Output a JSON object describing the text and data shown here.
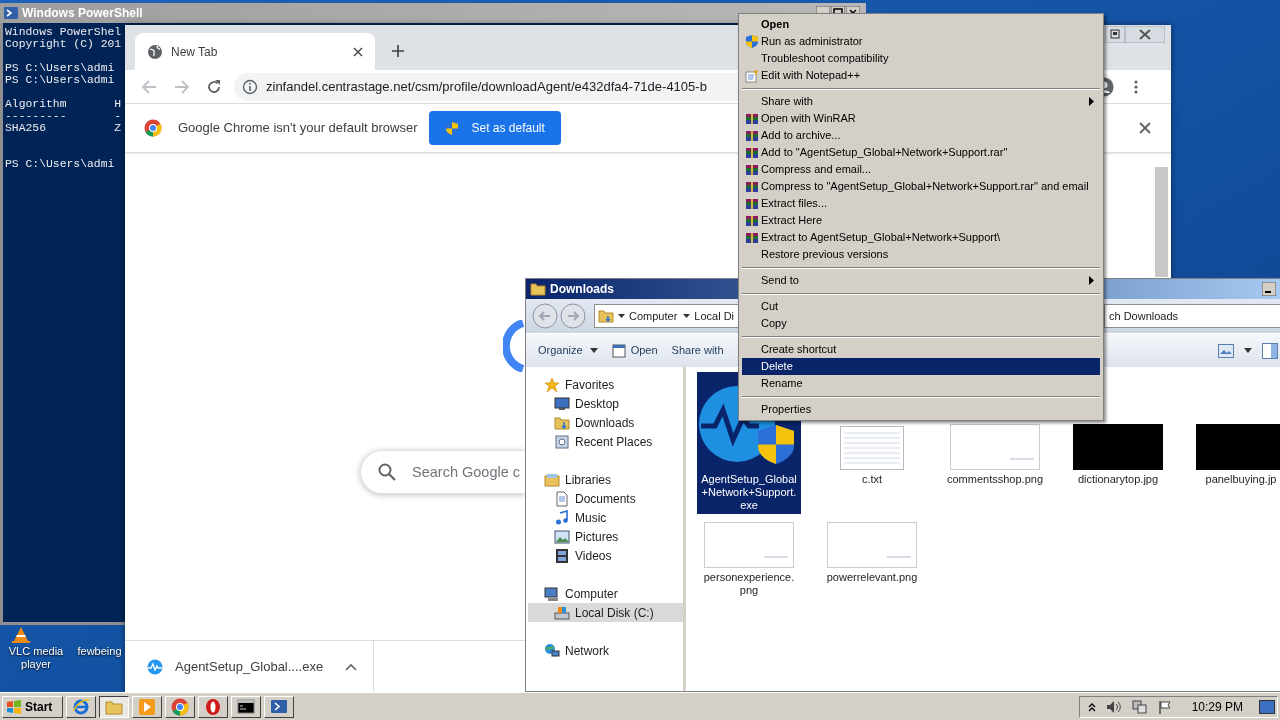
{
  "desktop": {
    "icons": [
      {
        "label": "VLC media player",
        "kind": "vlc"
      },
      {
        "label": "fewbeing",
        "kind": "file"
      }
    ]
  },
  "powershell": {
    "title": "Windows PowerShell",
    "blocks": [
      [
        "Windows PowerShel",
        "Copyright (C) 201"
      ],
      [
        "PS C:\\Users\\admi",
        "PS C:\\Users\\admi"
      ],
      [
        "Algorithm       H",
        "---------       -",
        "SHA256          Z"
      ],
      [
        "PS C:\\Users\\admi"
      ]
    ]
  },
  "chrome": {
    "tab": {
      "title": "New Tab"
    },
    "address": "zinfandel.centrastage.net/csm/profile/downloadAgent/e432dfa4-71de-4105-b",
    "infobar": {
      "message": "Google Chrome isn't your default browser",
      "button": "Set as default"
    },
    "search": {
      "placeholder": "Search Google c"
    },
    "download": {
      "filename": "AgentSetup_Global....exe"
    }
  },
  "explorer": {
    "title": "Downloads",
    "breadcrumbs": [
      "Computer",
      "Local Di"
    ],
    "search": {
      "placeholder": "ch Downloads"
    },
    "toolbar": [
      {
        "label": "Organize",
        "kind": "dropdown"
      },
      {
        "label": "Open",
        "kind": "open"
      },
      {
        "label": "Share with",
        "kind": "plain"
      }
    ],
    "nav": [
      {
        "label": "Favorites",
        "kind": "star",
        "selected": false,
        "children": [
          {
            "label": "Desktop",
            "kind": "desktop",
            "selected": false
          },
          {
            "label": "Downloads",
            "kind": "downloads",
            "selected": false
          },
          {
            "label": "Recent Places",
            "kind": "recent",
            "selected": false
          }
        ]
      },
      {
        "label": "Libraries",
        "kind": "libraries",
        "selected": false,
        "children": [
          {
            "label": "Documents",
            "kind": "documents",
            "selected": false
          },
          {
            "label": "Music",
            "kind": "music",
            "selected": false
          },
          {
            "label": "Pictures",
            "kind": "pictures",
            "selected": false
          },
          {
            "label": "Videos",
            "kind": "videos",
            "selected": false
          }
        ]
      },
      {
        "label": "Computer",
        "kind": "computer",
        "selected": false,
        "children": [
          {
            "label": "Local Disk (C:)",
            "kind": "drive",
            "selected": true
          }
        ]
      },
      {
        "label": "Network",
        "kind": "network",
        "selected": false
      }
    ],
    "files": [
      {
        "name": "AgentSetup_Global+Network+Support.exe",
        "kind": "app",
        "selected": true
      },
      {
        "name": "c.txt",
        "kind": "text",
        "selected": false
      },
      {
        "name": "commentsshop.png",
        "kind": "image-light",
        "selected": false
      },
      {
        "name": "dictionarytop.jpg",
        "kind": "image-dark",
        "selected": false
      },
      {
        "name": "panelbuying.jp",
        "kind": "image-dark",
        "selected": false
      },
      {
        "name": "personexperience.png",
        "kind": "image-light",
        "selected": false
      },
      {
        "name": "powerrelevant.png",
        "kind": "image-light",
        "selected": false
      }
    ]
  },
  "context_menu": {
    "items": [
      {
        "kind": "plain",
        "label": "Open",
        "bold": true,
        "submenu": false,
        "selected": false
      },
      {
        "kind": "shield",
        "label": "Run as administrator",
        "bold": false,
        "submenu": false,
        "selected": false
      },
      {
        "kind": "plain",
        "label": "Troubleshoot compatibility",
        "bold": false,
        "submenu": false,
        "selected": false
      },
      {
        "kind": "notepad",
        "label": "Edit with Notepad++",
        "bold": false,
        "submenu": false,
        "selected": false
      },
      {
        "kind": "separator"
      },
      {
        "kind": "plain",
        "label": "Share with",
        "bold": false,
        "submenu": true,
        "selected": false
      },
      {
        "kind": "winrar",
        "label": "Open with WinRAR",
        "bold": false,
        "submenu": false,
        "selected": false
      },
      {
        "kind": "winrar",
        "label": "Add to archive...",
        "bold": false,
        "submenu": false,
        "selected": false
      },
      {
        "kind": "winrar",
        "label": "Add to \"AgentSetup_Global+Network+Support.rar\"",
        "bold": false,
        "submenu": false,
        "selected": false
      },
      {
        "kind": "winrar",
        "label": "Compress and email...",
        "bold": false,
        "submenu": false,
        "selected": false
      },
      {
        "kind": "winrar",
        "label": "Compress to \"AgentSetup_Global+Network+Support.rar\" and email",
        "bold": false,
        "submenu": false,
        "selected": false
      },
      {
        "kind": "winrar",
        "label": "Extract files...",
        "bold": false,
        "submenu": false,
        "selected": false
      },
      {
        "kind": "winrar",
        "label": "Extract Here",
        "bold": false,
        "submenu": false,
        "selected": false
      },
      {
        "kind": "winrar",
        "label": "Extract to AgentSetup_Global+Network+Support\\",
        "bold": false,
        "submenu": false,
        "selected": false
      },
      {
        "kind": "plain",
        "label": "Restore previous versions",
        "bold": false,
        "submenu": false,
        "selected": false
      },
      {
        "kind": "separator"
      },
      {
        "kind": "plain",
        "label": "Send to",
        "bold": false,
        "submenu": true,
        "selected": false
      },
      {
        "kind": "separator"
      },
      {
        "kind": "plain",
        "label": "Cut",
        "bold": false,
        "submenu": false,
        "selected": false
      },
      {
        "kind": "plain",
        "label": "Copy",
        "bold": false,
        "submenu": false,
        "selected": false
      },
      {
        "kind": "separator"
      },
      {
        "kind": "plain",
        "label": "Create shortcut",
        "bold": false,
        "submenu": false,
        "selected": false
      },
      {
        "kind": "plain",
        "label": "Delete",
        "bold": false,
        "submenu": false,
        "selected": true
      },
      {
        "kind": "plain",
        "label": "Rename",
        "bold": false,
        "submenu": false,
        "selected": false
      },
      {
        "kind": "separator"
      },
      {
        "kind": "plain",
        "label": "Properties",
        "bold": false,
        "submenu": false,
        "selected": false
      }
    ]
  },
  "taskbar": {
    "start": "Start",
    "apps": [
      {
        "kind": "ie",
        "selected": false
      },
      {
        "kind": "explorer",
        "selected": true
      },
      {
        "kind": "media",
        "selected": false
      },
      {
        "kind": "chrome",
        "selected": false
      },
      {
        "kind": "opera",
        "selected": false
      },
      {
        "kind": "cmd",
        "selected": false
      },
      {
        "kind": "powershell",
        "selected": false
      }
    ],
    "clock": "10:29 PM"
  }
}
